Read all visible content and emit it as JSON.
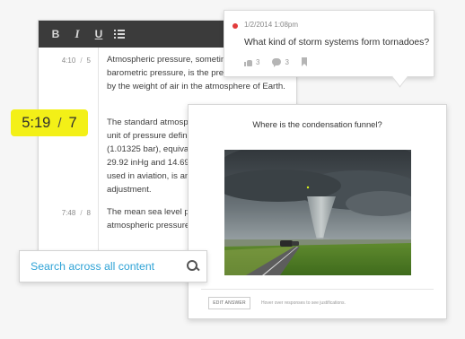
{
  "toolbar": {
    "bold_label": "B",
    "italic_label": "I",
    "underline_label": "U",
    "list_icon": "list-icon"
  },
  "transcript": {
    "paragraphs": [
      {
        "time": "4:10",
        "index": "5",
        "text": "Atmospheric pressure, sometimes also called barometric pressure, is the pressure exerted by the weight of air in the atmosphere of Earth."
      },
      {
        "time": "",
        "index": "",
        "text": "The standard atmosphere (symbol: atm) is a unit of pressure defined as 101325 Pa (1.01325 bar), equivalent to 760 mmHg (torr), 29.92 inHg and 14.696 psi. The atm unit is used in aviation, is an atmospheric pressure adjustment."
      },
      {
        "time": "7:48",
        "index": "8",
        "text": "The mean sea level pressure (MSLP) is the atmospheric pressure at sea level."
      }
    ]
  },
  "badge": {
    "time": "5:19",
    "separator": "/",
    "index": "7",
    "color": "#f3f017"
  },
  "comment": {
    "timestamp": "1/2/2014 1:08pm",
    "question": "What kind of storm systems form tornadoes?",
    "likes": "3",
    "replies": "3",
    "status_color": "#e23b3b"
  },
  "question_card": {
    "title": "Where is the condensation funnel?",
    "edit_button": "EDIT ANSWER",
    "hint": "Hover over responses to see justifications."
  },
  "search": {
    "placeholder": "Search across all content",
    "value": "",
    "accent_color": "#2fa3d6"
  }
}
